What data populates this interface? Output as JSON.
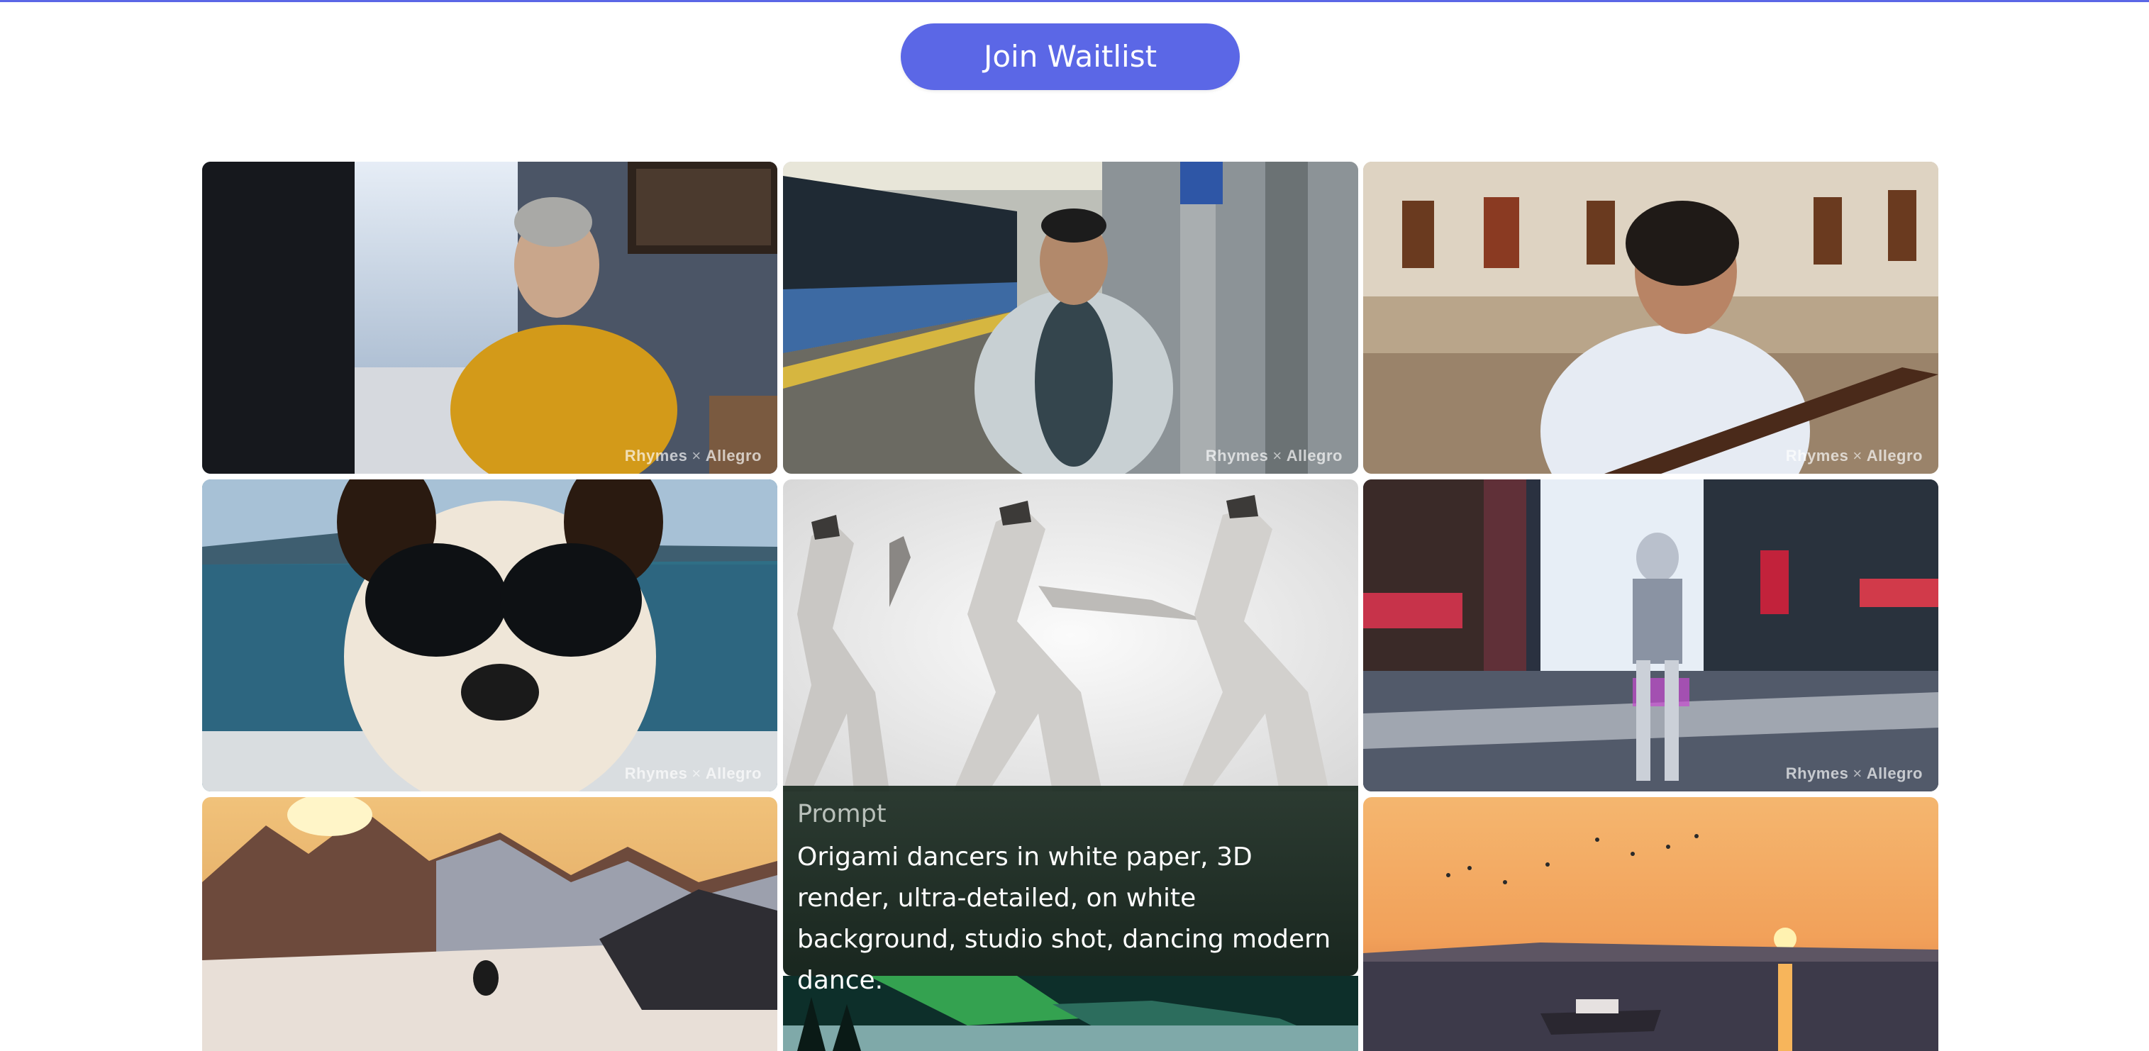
{
  "header": {
    "cta_label": "Join Waitlist",
    "accent_color": "#5b67e6"
  },
  "gallery": {
    "watermark_left": "Rhymes",
    "watermark_sep": "×",
    "watermark_right": "Allegro",
    "prompt_overlay": {
      "label": "Prompt",
      "text": "Origami dancers in white paper, 3D render, ultra-detailed, on white background, studio shot, dancing modern dance."
    },
    "tiles": [
      {
        "subject": "older man in mustard sweater by snowy window"
      },
      {
        "subject": "man in vest on train platform"
      },
      {
        "subject": "girl with glasses reading book in gallery"
      },
      {
        "subject": "dog wearing goggles on boat"
      },
      {
        "subject": "origami paper dancers"
      },
      {
        "subject": "robot walking in city street"
      },
      {
        "subject": "snowboarder in mountains at sunset"
      },
      {
        "subject": "aurora over snowy landscape"
      },
      {
        "subject": "boat on sea at sunset with birds"
      }
    ]
  }
}
